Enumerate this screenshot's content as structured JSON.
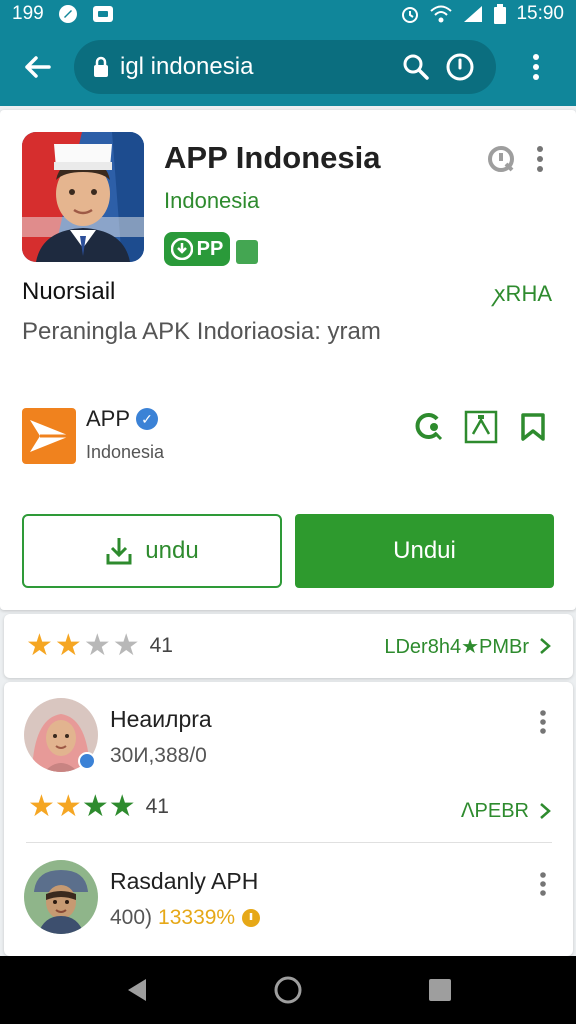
{
  "status_bar": {
    "time_left": "199",
    "time_right": "15:90"
  },
  "toolbar": {
    "search_query": "igl indonesia"
  },
  "app": {
    "title": "APP Indonesia",
    "developer": "Indonesia",
    "badge_label": "PP",
    "label_left": "Nuorsiail",
    "label_right": "ꭗRHA",
    "description": "Peraningla APK Indoriaosia: yram"
  },
  "publisher": {
    "name": "APP",
    "subtitle": "Indonesia"
  },
  "buttons": {
    "outline_label": "undu",
    "filled_label": "Undui"
  },
  "rating": {
    "count": "41",
    "link_label": "LDer8h4★PMBr"
  },
  "reviews": [
    {
      "name": "Heaилpra",
      "subtitle": "30И,388/0",
      "count": "41",
      "link_label": "ⴷPEBR"
    },
    {
      "name": "Rasdanly APH",
      "subtitle_a": "400)",
      "subtitle_b": "13339%"
    }
  ],
  "colors": {
    "accent_teal": "#10869a",
    "green": "#2e9a2e",
    "star_gold": "#f5a623",
    "publisher_orange": "#f0821e"
  },
  "icons": {
    "status_left": [
      "circle-app-icon",
      "square-app-icon"
    ],
    "status_right": [
      "alarm-icon",
      "wifi-icon",
      "signal-icon",
      "battery-icon"
    ],
    "toolbar": [
      "back-arrow-icon",
      "lock-icon",
      "search-icon",
      "clock-icon",
      "overflow-icon"
    ]
  }
}
